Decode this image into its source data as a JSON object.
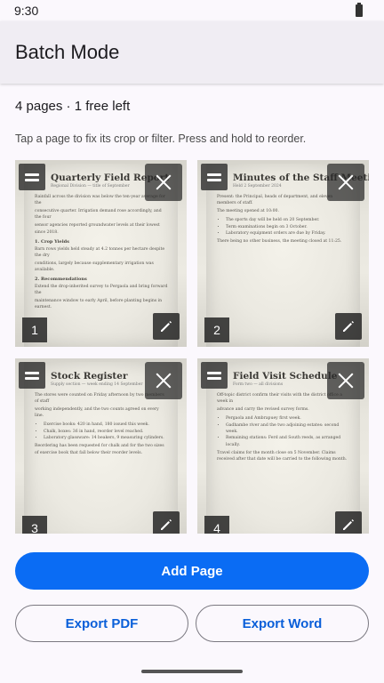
{
  "status_bar": {
    "time": "9:30"
  },
  "app_bar": {
    "title": "Batch Mode"
  },
  "summary": {
    "counter": "4 pages · 1 free left"
  },
  "hint": "Tap a page to fix its crop or filter. Press and hold to reorder.",
  "pages": [
    {
      "number": "1",
      "doc_title": "Quarterly Field Report",
      "doc_sub": "Regional Division — title of September",
      "lines": [
        "Rainfall across the division was below the ten-year average for the",
        "consecutive quarter. Irrigation demand rose accordingly, and the four",
        "sensor agencies reported groundwater levels at their lowest since 2018."
      ],
      "section1": "1. Crop Yields",
      "section1_lines": [
        "Barn rows yields held steady at 4.2 tonnes per hectare despite the dry",
        "conditions, largely because supplementary irrigation was available."
      ],
      "section2": "2. Recommendations",
      "section2_lines": [
        "Extend the drop-inherited survey to Pergaola and bring forward the",
        "maintenance window to early April, before planting begins in earnest."
      ]
    },
    {
      "number": "2",
      "doc_title": "Minutes of the Staff Meeting",
      "doc_sub": "Held 2 September 2024",
      "lines": [
        "Present: the Principal, heads of department, and eleven members of staff.",
        "The meeting opened at 10:00."
      ],
      "bullets": [
        "The sports day will be held on 20 September.",
        "Term examinations begin on 3 October.",
        "Laboratory equipment orders are due by Friday."
      ],
      "closing": "There being no other business, the meeting closed at 11:25."
    },
    {
      "number": "3",
      "doc_title": "Stock Register",
      "doc_sub": "Supply section — week ending 14 September",
      "lines": [
        "The stores were counted on Friday afternoon by two members of staff",
        "working independently, and the two counts agreed on every line."
      ],
      "bullets": [
        "Exercise books: 420 in hand, 180 issued this week.",
        "Chalk, boxes: 36 in hand, reorder level reached.",
        "Laboratory glassware: 14 beakers, 9 measuring cylinders."
      ],
      "closing": "Reordering has been requested for chalk and for the two sizes of exercise book that fall below their reorder levels."
    },
    {
      "number": "4",
      "doc_title": "Field Visit Schedule",
      "doc_sub": "Form two — all divisions",
      "lines": [
        "Off-topic district confirm their visits with the district office a week in",
        "advance and carry the revised survey forms."
      ],
      "bullets": [
        "Pergaola and Ambrapuey first week.",
        "Gadhambe river and the two adjoining estates: second week.",
        "Remaining stations: Ferd and South reeds, as arranged locally."
      ],
      "closing": "Travel claims for the month close on 5 November. Claims received after that date will be carried to the following month."
    }
  ],
  "actions": {
    "add_page": "Add Page",
    "export_pdf": "Export PDF",
    "export_word": "Export Word"
  }
}
